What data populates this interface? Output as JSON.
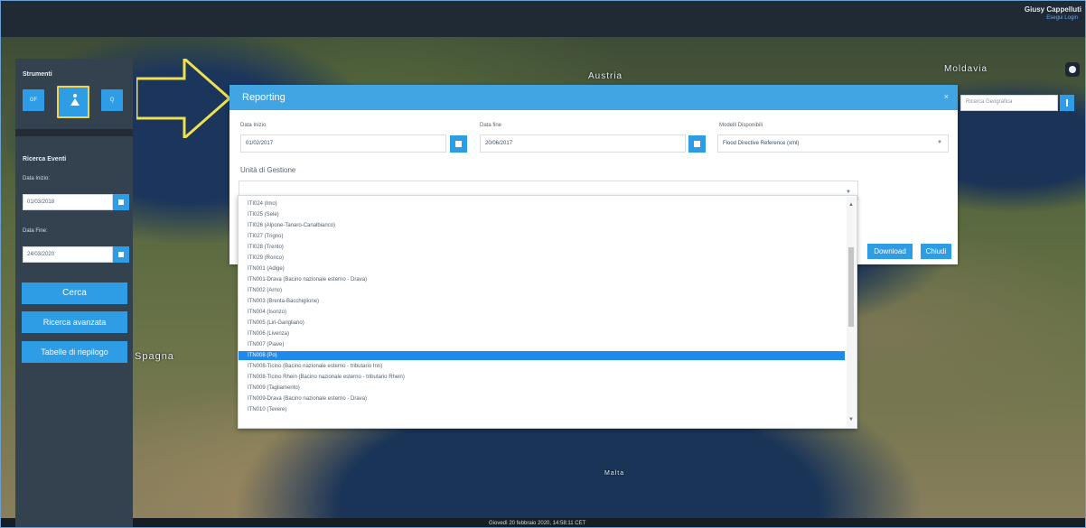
{
  "user": {
    "name": "Giusy Cappelluti",
    "subtitle": "Esegui Login"
  },
  "map": {
    "labels": [
      "Austria",
      "Moldavia",
      "Spagna",
      "Malta"
    ],
    "bottom_text": "Giovedì 20 febbraio 2020, 14:58:11 CET",
    "geo_search_placeholder": "Ricerca Geografica"
  },
  "left": {
    "tools_title": "Strumenti",
    "tools": [
      "GF",
      "",
      "Q"
    ],
    "search_title": "Ricerca Eventi",
    "start_label": "Data Inizio:",
    "start_value": "01/03/2018",
    "end_label": "Data Fine:",
    "end_value": "24/03/2020",
    "actions": [
      "Cerca",
      "Ricerca avanzata",
      "Tabelle di riepilogo"
    ]
  },
  "reporting": {
    "title": "Reporting",
    "start_label": "Data Inizio",
    "start_value": "01/02/2017",
    "end_label": "Data fine",
    "end_value": "20/06/2017",
    "models_label": "Modelli Disponibili",
    "model_value": "Flood Directive Reference (xml)",
    "unita_label": "Unità di Gestione",
    "download": "Download",
    "close": "Chiudi"
  },
  "list": {
    "items": [
      "ITI024 (Imo)",
      "ITI025 (Sele)",
      "ITI026 (Alpone-Tanaro-Canalbianco)",
      "ITI027 (Trigno)",
      "ITI028 (Trento)",
      "ITI029 (Ronco)",
      "ITN001 (Adige)",
      "ITN001-Drava (Bacino nazionale esterno - Drava)",
      "ITN002 (Arno)",
      "ITN003 (Brenta-Bacchiglione)",
      "ITN004 (Isonzo)",
      "ITN005 (Liri-Garigliano)",
      "ITN006 (Livenza)",
      "ITN007 (Piave)",
      "ITN008 (Po)",
      "ITN008-Ticino (Bacino nazionale esterno - tributario Inn)",
      "ITN008-Ticino Rhein (Bacino nazionale esterno - tributario Rhein)",
      "ITN009 (Tagliamento)",
      "ITN009-Drava (Bacino nazionale esterno - Drava)",
      "ITN010 (Tevere)"
    ],
    "selected": "ITN008 (Po)"
  }
}
